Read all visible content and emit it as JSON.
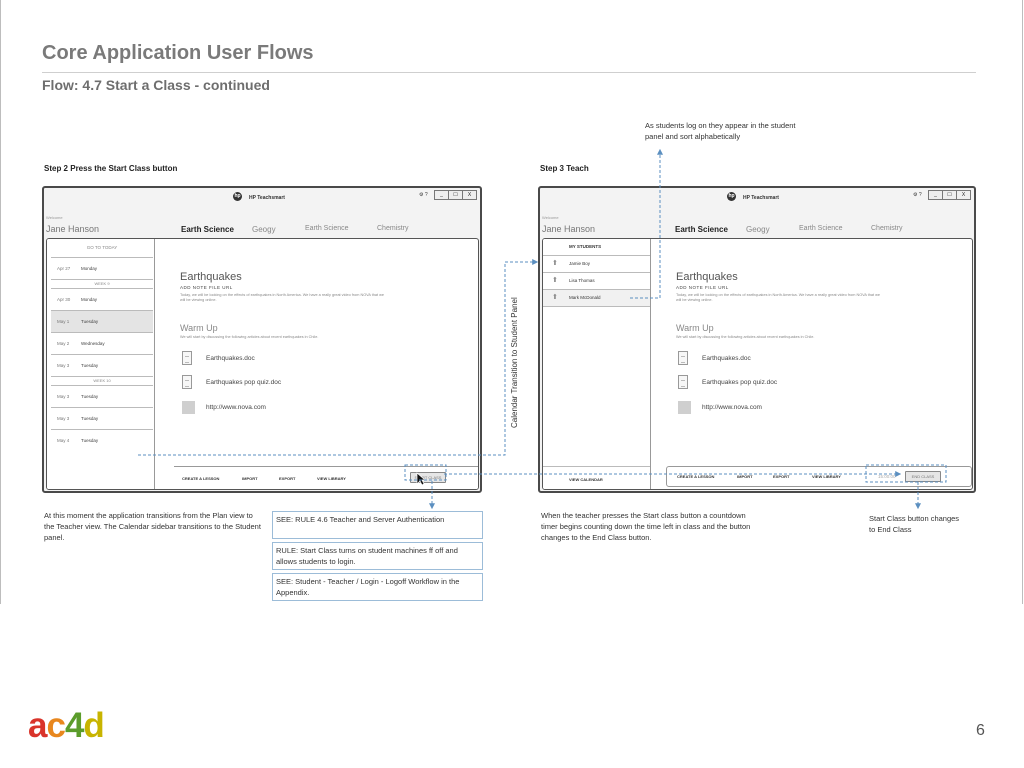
{
  "header": {
    "title": "Core Application User Flows",
    "subtitle": "Flow: 4.7 Start a Class - continued"
  },
  "steps": {
    "step2_label": "Step 2 Press the Start Class button",
    "step3_label": "Step 3 Teach"
  },
  "app_window": {
    "app_name": "HP Teachsmart",
    "welcome": "Welcome",
    "user_name": "Jane Hanson",
    "window_controls": [
      "⚙ ?",
      "_",
      "☐",
      "X"
    ],
    "tabs": [
      "Earth Science",
      "Geogy",
      "Earth Science",
      "Chemistry"
    ],
    "content": {
      "heading": "Earthquakes",
      "sub": "ADD  NOTE  FILE  URL",
      "body": "Today, we will be looking on the effects of earthquakes in North America. We have a really great video from NOVA that we will be viewing online.",
      "warm_up": "Warm Up",
      "warm_up_body": "We will start by discussing the following articles about recent earthquakes in Chile.",
      "files": [
        "Earthquakes.doc",
        "Earthquakes pop quiz.doc"
      ],
      "link": "http://www.nova.com"
    }
  },
  "calendar": {
    "go_today": "GO TO TODAY",
    "rows": [
      {
        "date": "Apr 27",
        "day": "Monday"
      },
      {
        "date": "Apr 30",
        "day": "Monday"
      },
      {
        "date": "May 1",
        "day": "Tuesday"
      },
      {
        "date": "May 2",
        "day": "Wednesday"
      },
      {
        "date": "May 3",
        "day": "Tuesday"
      },
      {
        "date": "May 3",
        "day": "Tuesday"
      },
      {
        "date": "May 3",
        "day": "Tuesday"
      },
      {
        "date": "May 4",
        "day": "Tuesday"
      }
    ],
    "week_heads": [
      "WEEK 9",
      "WEEK 10"
    ]
  },
  "students": {
    "header": "MY STUDENTS",
    "list": [
      "Jamie Boy",
      "Lisa Thomas",
      "Mark McDonald"
    ]
  },
  "toolbar_step2": {
    "items": [
      "CREATE A LESSON",
      "IMPORT",
      "EXPORT",
      "VIEW LIBRARY"
    ],
    "button": "START CLASS"
  },
  "toolbar_step3": {
    "left": "VIEW CALENDAR",
    "items": [
      "CREATE A LESSON",
      "IMPORT",
      "EXPORT",
      "VIEW LIBRARY"
    ],
    "timer": "15:00:00",
    "button": "END CLASS"
  },
  "annotations": {
    "students_log_on": "As students log on they appear in the student panel and sort alphabetically",
    "transition_label": "Calendar Transition to Student Panel",
    "left_note": "At this moment the application transitions from the Plan view to the Teacher view. The Calendar sidebar transitions to the Student panel.",
    "box1": "SEE: RULE 4.6 Teacher and Server Authentication",
    "box2": "RULE: Start Class turns on student machines ff off and allows students to login.",
    "box3": "SEE: Student - Teacher / Login - Logoff Workflow in the Appendix.",
    "middle_note": "When the teacher presses the Start class button a countdown timer begins counting down the time left in class and the button changes to the End Class button.",
    "right_note": "Start Class button changes to End Class"
  },
  "footer": {
    "logo_letters": [
      "a",
      "c",
      "4",
      "d"
    ],
    "logo_colors": [
      "#d9342b",
      "#e8871e",
      "#5b9c2b",
      "#c8b400"
    ],
    "page_number": "6"
  },
  "colors": {
    "arrow": "#5b8fc0"
  }
}
